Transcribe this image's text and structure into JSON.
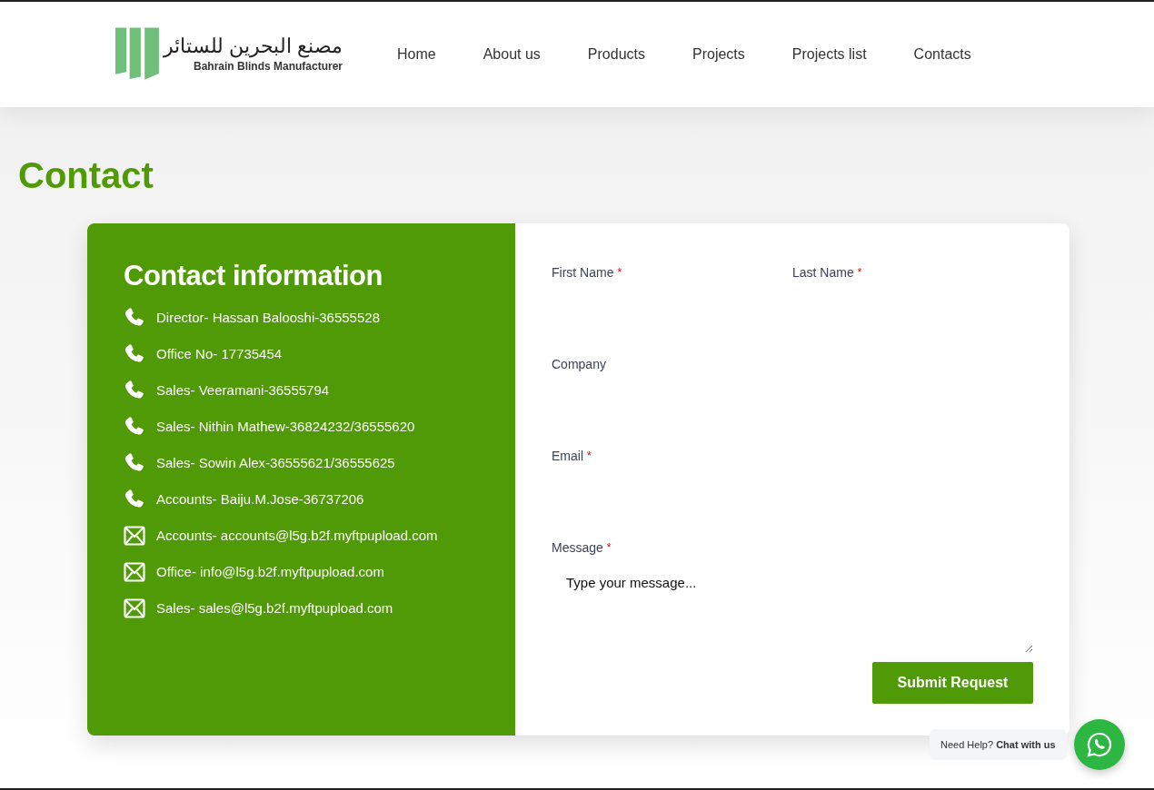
{
  "logo": {
    "arabic": "مصنع البحرين للستائر",
    "english": "Bahrain Blinds Manufacturer"
  },
  "nav": [
    {
      "label": "Home"
    },
    {
      "label": "About us"
    },
    {
      "label": "Products"
    },
    {
      "label": "Projects"
    },
    {
      "label": "Projects list"
    },
    {
      "label": "Contacts"
    }
  ],
  "page_title": "Contact",
  "contact_info": {
    "title": "Contact information",
    "items": [
      {
        "kind": "phone",
        "text": "Director- Hassan Balooshi-36555528"
      },
      {
        "kind": "phone",
        "text": "Office No- 17735454"
      },
      {
        "kind": "phone",
        "text": "Sales- Veeramani-36555794"
      },
      {
        "kind": "phone",
        "text": "Sales- Nithin Mathew-36824232/36555620"
      },
      {
        "kind": "phone",
        "text": "Sales- Sowin Alex-36555621/36555625"
      },
      {
        "kind": "phone",
        "text": "Accounts- Baiju.M.Jose-36737206"
      },
      {
        "kind": "email",
        "text": "Accounts- accounts@l5g.b2f.myftpupload.com"
      },
      {
        "kind": "email",
        "text": "Office- info@l5g.b2f.myftpupload.com"
      },
      {
        "kind": "email",
        "text": "Sales- sales@l5g.b2f.myftpupload.com"
      }
    ]
  },
  "form": {
    "rows": [
      [
        {
          "label": "First Name",
          "required_mark": "*",
          "kind": "input"
        },
        {
          "label": "Last Name",
          "required_mark": "*",
          "kind": "input"
        }
      ],
      [
        {
          "label": "Company",
          "kind": "input"
        }
      ],
      [
        {
          "label": "Email",
          "required_mark": "*",
          "kind": "input"
        }
      ],
      [
        {
          "label": "Message",
          "required_mark": "*",
          "kind": "textarea",
          "placeholder": "Type your message..."
        }
      ]
    ],
    "submit": "Submit Request"
  },
  "chat_widget": {
    "text": "Need Help? **Chat with us**"
  }
}
